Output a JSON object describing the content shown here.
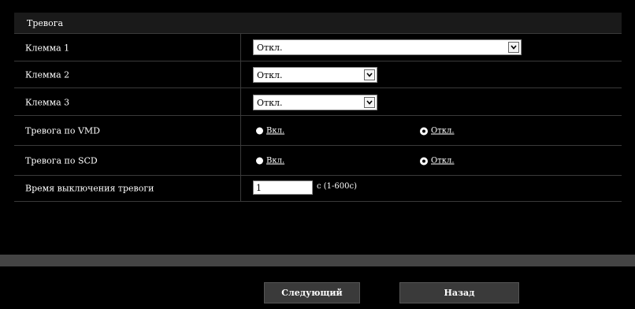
{
  "section": {
    "title": "Тревога"
  },
  "rows": {
    "terminal1": {
      "label": "Клемма 1",
      "value": "Откл."
    },
    "terminal2": {
      "label": "Клемма 2",
      "value": "Откл."
    },
    "terminal3": {
      "label": "Клемма 3",
      "value": "Откл."
    },
    "vmd": {
      "label": "Тревога по VMD",
      "on": "Вкл.",
      "off": "Откл.",
      "selected": "off"
    },
    "scd": {
      "label": "Тревога по SCD",
      "on": "Вкл.",
      "off": "Откл.",
      "selected": "off"
    },
    "off_time": {
      "label": "Время выключения тревоги",
      "value": "1",
      "unit": "с (1-600с)"
    }
  },
  "buttons": {
    "next": "Следующий",
    "back": "Назад"
  },
  "icons": {
    "select_arrow": "chevron-down-icon"
  }
}
